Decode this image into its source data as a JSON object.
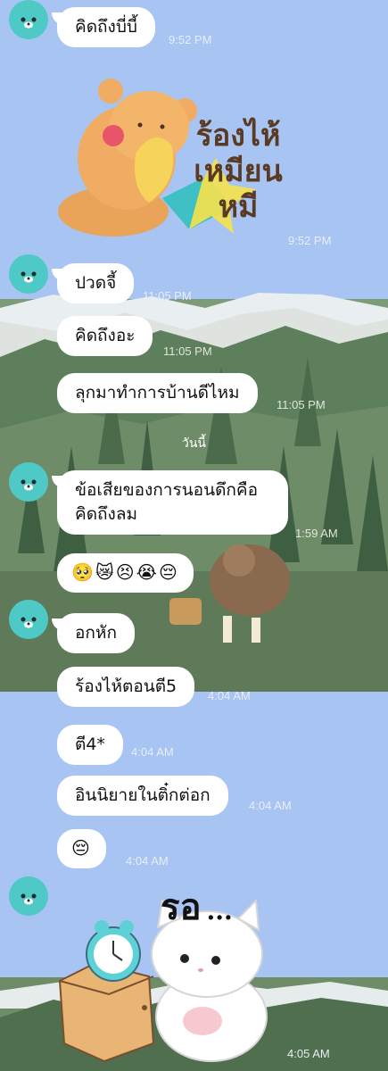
{
  "colors": {
    "sky": "#a7c4f3",
    "bubble": "#ffffff",
    "avatar": "#4fc9c6",
    "forest": "#6f8f6a"
  },
  "messages": [
    {
      "id": "m1",
      "type": "text",
      "text": "คิดถึงบี่บี้",
      "time": "9:52 PM"
    },
    {
      "id": "m2",
      "type": "sticker",
      "sticker": "crying-bear-sticker",
      "sticker_text": [
        "ร้องไห้",
        "เหมียน",
        "หมี"
      ],
      "time": "9:52 PM"
    },
    {
      "id": "m3",
      "type": "text",
      "text": "ปวดจี้",
      "time": "11:05 PM"
    },
    {
      "id": "m4",
      "type": "text",
      "text": "คิดถึงอะ",
      "time": "11:05 PM"
    },
    {
      "id": "m5",
      "type": "text",
      "text": "ลุกมาทำการบ้านดีไหม",
      "time": "11:05 PM"
    },
    {
      "id": "m6",
      "type": "text",
      "lines": [
        "ข้อเสียของการนอนดึกคือ",
        "คิดถึงลม"
      ],
      "time": "1:59 AM"
    },
    {
      "id": "m7",
      "type": "emoji",
      "text": "🥺😿😣😭😔"
    },
    {
      "id": "m8",
      "type": "text",
      "text": "อกหัก"
    },
    {
      "id": "m9",
      "type": "text",
      "text": "ร้องไห้ตอนตี5",
      "time": "4:04 AM"
    },
    {
      "id": "m10",
      "type": "text",
      "text": "ตี4*",
      "time": "4:04 AM"
    },
    {
      "id": "m11",
      "type": "text",
      "text": "อินนิยายในติ๋กต่อก",
      "time": "4:04 AM"
    },
    {
      "id": "m12",
      "type": "emoji",
      "text": "😔",
      "time": "4:04 AM"
    },
    {
      "id": "m13",
      "type": "sticker",
      "sticker": "waiting-cat-clock-sticker",
      "sticker_text": [
        "รอ",
        "..."
      ],
      "time": "4:05 AM"
    }
  ],
  "date_separator": "วันนี้"
}
